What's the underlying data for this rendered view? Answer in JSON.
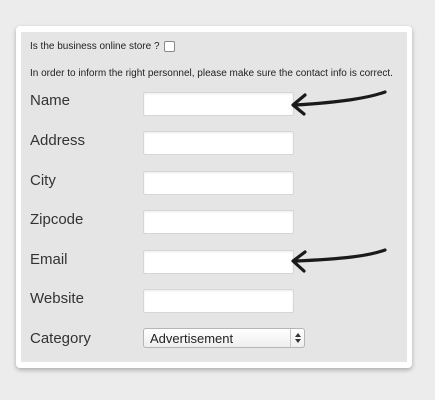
{
  "form": {
    "online_store_question": "Is the business online store ?",
    "online_store_checked": false,
    "notice": "In order to inform the right personnel, please make sure the contact info is correct.",
    "fields": [
      {
        "label": "Name",
        "value": ""
      },
      {
        "label": "Address",
        "value": ""
      },
      {
        "label": "City",
        "value": ""
      },
      {
        "label": "Zipcode",
        "value": ""
      },
      {
        "label": "Email",
        "value": ""
      },
      {
        "label": "Website",
        "value": ""
      }
    ],
    "category": {
      "label": "Category",
      "selected": "Advertisement"
    }
  },
  "annotations": {
    "arrow_color": "#1a1a1a",
    "arrows": [
      "hand-drawn-arrow-icon",
      "hand-drawn-arrow-icon"
    ]
  },
  "colors": {
    "background": "#ececec",
    "panel": "#e5e5e5",
    "card": "#ffffff"
  }
}
